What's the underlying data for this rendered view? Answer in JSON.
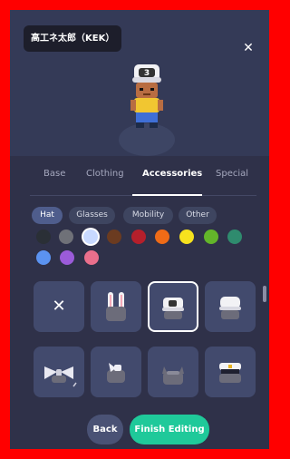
{
  "character": {
    "name": "高工ネ太郎（KEK）",
    "hat_number": "3"
  },
  "close_icon": "close-icon",
  "tabs": [
    {
      "label": "Base",
      "active": false
    },
    {
      "label": "Clothing",
      "active": false
    },
    {
      "label": "Accessories",
      "active": true
    },
    {
      "label": "Special",
      "active": false
    }
  ],
  "categories": [
    {
      "label": "Hat",
      "active": true
    },
    {
      "label": "Glasses",
      "active": false
    },
    {
      "label": "Mobility",
      "active": false
    },
    {
      "label": "Other",
      "active": false
    }
  ],
  "colors": {
    "swatches": [
      "#2a2f36",
      "#6f7178",
      "#c8d9ff",
      "#6b3b20",
      "#b51f2b",
      "#ef6b17",
      "#f6e21e",
      "#63b52a",
      "#2f8b6e",
      "#5b93f1",
      "#9b5bd9",
      "#ea6f8c"
    ],
    "selected_index": 2
  },
  "items": [
    {
      "name": "none",
      "icon": "close-icon"
    },
    {
      "name": "bunny-ears",
      "icon": "bunny-ears-icon"
    },
    {
      "name": "numbered-cap",
      "icon": "numbered-cap-icon",
      "selected": true
    },
    {
      "name": "plain-cap",
      "icon": "cap-icon"
    },
    {
      "name": "bow",
      "icon": "bow-icon"
    },
    {
      "name": "bird-hat",
      "icon": "bird-hat-icon"
    },
    {
      "name": "cat-ears",
      "icon": "cat-ears-icon"
    },
    {
      "name": "captain-hat",
      "icon": "captain-hat-icon"
    }
  ],
  "actions": {
    "back": "Back",
    "finish": "Finish Editing"
  }
}
